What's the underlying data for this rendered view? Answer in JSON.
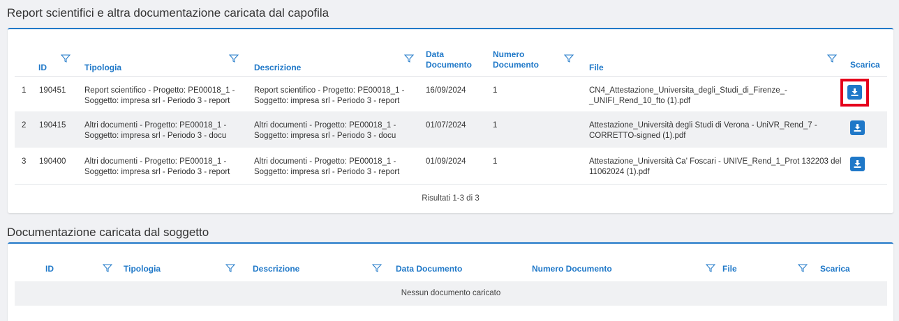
{
  "section1": {
    "title": "Report scientifici e altra documentazione caricata dal capofila",
    "headers": {
      "id": "ID",
      "tipologia": "Tipologia",
      "descrizione": "Descrizione",
      "data_line1": "Data",
      "data_line2": "Documento",
      "numero_line1": "Numero",
      "numero_line2": "Documento",
      "file": "File",
      "scarica": "Scarica"
    },
    "rows": [
      {
        "index": "1",
        "id": "190451",
        "tipologia_1": "Report scientifico - Progetto: PE00018_1 -",
        "tipologia_2": "Soggetto: impresa srl - Periodo 3 - report",
        "descrizione_1": "Report scientifico - Progetto: PE00018_1 -",
        "descrizione_2": "Soggetto: impresa srl - Periodo 3 - report",
        "data": "16/09/2024",
        "numero": "1",
        "file_1": "CN4_Attestazione_Universita_degli_Studi_di_Firenze_-",
        "file_2": "_UNIFI_Rend_10_fto (1).pdf"
      },
      {
        "index": "2",
        "id": "190415",
        "tipologia_1": "Altri documenti - Progetto: PE00018_1 -",
        "tipologia_2": "Soggetto: impresa srl - Periodo 3 - docu",
        "descrizione_1": "Altri documenti - Progetto: PE00018_1 -",
        "descrizione_2": "Soggetto: impresa srl - Periodo 3 - docu",
        "data": "01/07/2024",
        "numero": "1",
        "file_1": "Attestazione_Università degli Studi di Verona - UniVR_Rend_7 -",
        "file_2": "CORRETTO-signed (1).pdf"
      },
      {
        "index": "3",
        "id": "190400",
        "tipologia_1": "Altri documenti - Progetto: PE00018_1 -",
        "tipologia_2": "Soggetto: impresa srl - Periodo 3 - report",
        "descrizione_1": "Altri documenti - Progetto: PE00018_1 -",
        "descrizione_2": "Soggetto: impresa srl - Periodo 3 - report",
        "data": "01/09/2024",
        "numero": "1",
        "file_1": "Attestazione_Università Ca' Foscari - UNIVE_Rend_1_Prot 132203 del",
        "file_2": "11062024 (1).pdf"
      }
    ],
    "footer": "Risultati 1-3 di 3"
  },
  "section2": {
    "title": "Documentazione caricata dal soggetto",
    "headers": {
      "id": "ID",
      "tipologia": "Tipologia",
      "descrizione": "Descrizione",
      "data": "Data Documento",
      "numero": "Numero Documento",
      "file": "File",
      "scarica": "Scarica"
    },
    "empty": "Nessun documento caricato"
  },
  "icons": {
    "filter": "filter-funnel-icon",
    "download": "download-icon"
  },
  "colors": {
    "accent": "#1f78c8",
    "highlight": "#e5001c"
  }
}
